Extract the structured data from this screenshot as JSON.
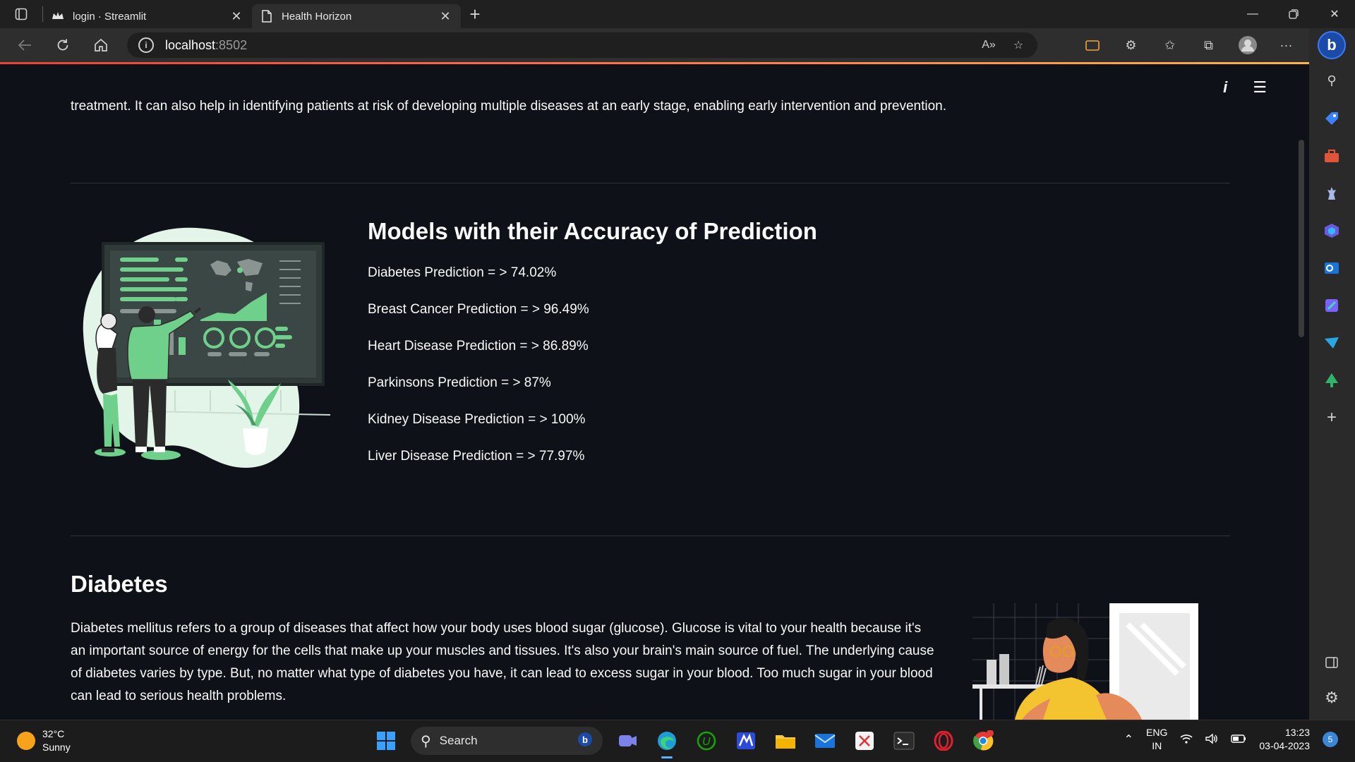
{
  "browser": {
    "tabs": [
      {
        "title": "login · Streamlit",
        "active": false
      },
      {
        "title": "Health Horizon",
        "active": true
      }
    ],
    "url_host": "localhost",
    "url_port": ":8502"
  },
  "page": {
    "intro": "treatment. It can also help in identifying patients at risk of developing multiple diseases at an early stage, enabling early intervention and prevention.",
    "models_title": "Models with their Accuracy of Prediction",
    "models": [
      "Diabetes Prediction = > 74.02%",
      "Breast Cancer Prediction = > 96.49%",
      "Heart Disease Prediction = > 86.89%",
      "Parkinsons Prediction = > 87%",
      "Kidney Disease Prediction = > 100%",
      "Liver Disease Prediction = > 77.97%"
    ],
    "diabetes_title": "Diabetes",
    "diabetes_text": "Diabetes mellitus refers to a group of diseases that affect how your body uses blood sugar (glucose). Glucose is vital to your health because it's an important source of energy for the cells that make up your muscles and tissues. It's also your brain's main source of fuel. The underlying cause of diabetes varies by type. But, no matter what type of diabetes you have, it can lead to excess sugar in your blood. Too much sugar in your blood can lead to serious health problems."
  },
  "taskbar": {
    "weather_temp": "32°C",
    "weather_cond": "Sunny",
    "search_label": "Search",
    "lang_line1": "ENG",
    "lang_line2": "IN",
    "time": "13:23",
    "date": "03-04-2023",
    "notif_count": "5"
  },
  "colors": {
    "page_bg": "#0e1117",
    "accent_green": "#6fd08c",
    "illus_mint": "#e3f5e9"
  }
}
